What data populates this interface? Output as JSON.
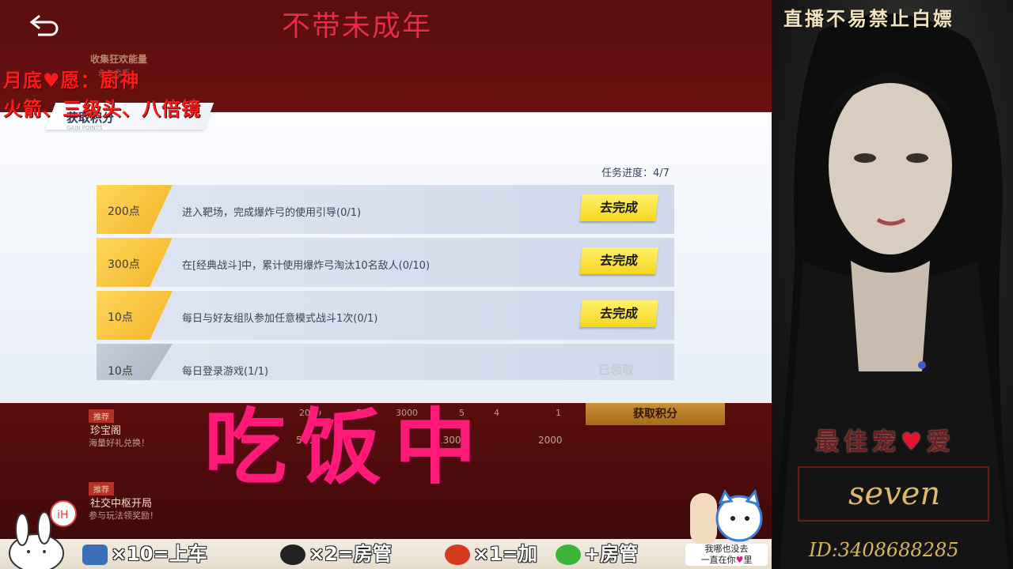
{
  "overlay": {
    "top_title": "不带未成年",
    "wish_line1": "月底♥愿：厨神",
    "wish_line2": "火箭、三级头、八倍镜",
    "eating": "吃饭中",
    "side_title": "直播不易禁止白嫖",
    "best_prefix": "最佳宠",
    "best_heart": "♥",
    "best_suffix": "爱",
    "streamer_name": "seven",
    "room_id": "ID:3408688285",
    "sticker_line1": "我哪也没去",
    "sticker_line2": "一直在你",
    "sticker_heart": "♥",
    "sticker_line3": "里",
    "bottom_gifts": [
      {
        "label": "×10=上车",
        "icon": "gift-box-icon",
        "color": "#3a6fb8"
      },
      {
        "label": "×2=房管",
        "icon": "helmet-icon",
        "color": "#222222"
      },
      {
        "label": "×1=加",
        "icon": "rocket-icon",
        "color": "#d33a1e"
      },
      {
        "label": "+房管",
        "icon": "wechat-icon",
        "color": "#3ab53a"
      }
    ]
  },
  "game": {
    "bg_texts": {
      "carnival": "收集狂欢能量",
      "carnival_sub": "永久金币",
      "treasure_badge": "推荐",
      "treasure": "珍宝阁",
      "treasure_sub": "海量好礼兑换！",
      "social_badge": "推荐",
      "social": "社交中枢开局",
      "social_sub": "参与玩法领奖励！",
      "gold_button": "获取积分",
      "milestones": [
        "2000",
        "5",
        "3000",
        "5",
        "4",
        "1"
      ],
      "milestones2": [
        "500",
        "1300",
        "2000"
      ]
    },
    "panel": {
      "tab_title": "获取积分",
      "tab_subtitle": "GAIN POINTS",
      "progress": "任务进度：4/7",
      "tasks": [
        {
          "points": "200点",
          "desc": "进入靶场，完成爆炸弓的使用引导(0/1)",
          "action": "去完成",
          "done": false
        },
        {
          "points": "300点",
          "desc": "在[经典战斗]中，累计使用爆炸弓淘汰10名敌人(0/10)",
          "action": "去完成",
          "done": false
        },
        {
          "points": "10点",
          "desc": "每日与好友组队参加任意模式战斗1次(0/1)",
          "action": "去完成",
          "done": false
        },
        {
          "points": "10点",
          "desc": "每日登录游戏(1/1)",
          "action": "已领取",
          "done": true
        }
      ]
    }
  }
}
